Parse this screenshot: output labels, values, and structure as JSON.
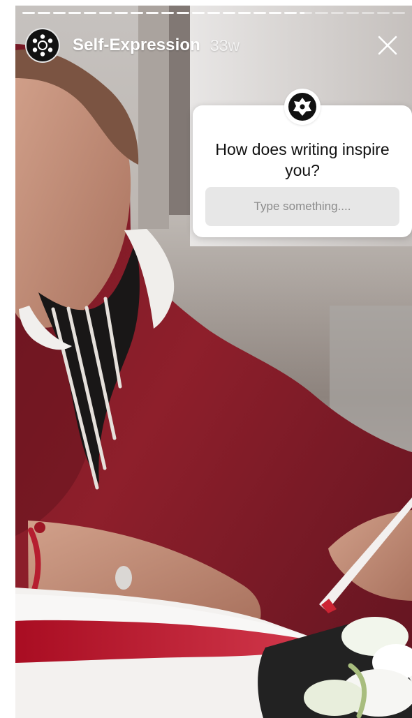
{
  "story": {
    "account_name": "Self-Expression",
    "post_age": "33w",
    "segments": 25,
    "completed_segments": 18,
    "active_segment_progress": 0.4
  },
  "question_sticker": {
    "question": "How does writing inspire you?",
    "input_placeholder": "Type something...."
  },
  "icons": {
    "avatar": "brand-logo-icon",
    "close": "close-icon",
    "sticker": "brand-star-icon"
  },
  "colors": {
    "sweater": "#8e1f2b",
    "notebook": "#b3172a",
    "card": "#ffffff",
    "input_background": "#e7e7e7"
  }
}
